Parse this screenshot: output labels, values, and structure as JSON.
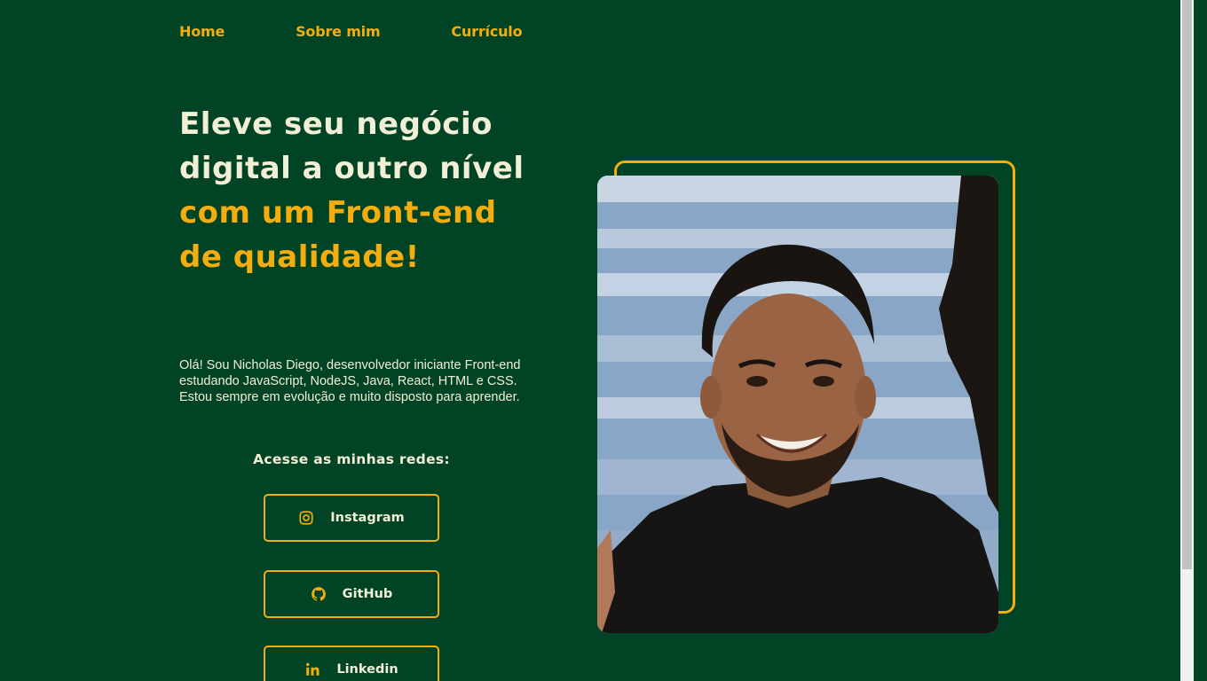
{
  "nav": {
    "items": [
      "Home",
      "Sobre mim",
      "Currículo"
    ]
  },
  "hero": {
    "headline_plain": "Eleve seu negócio digital a outro nível ",
    "headline_accent": "com um Front-end de qualidade!",
    "intro": "Olá! Sou Nicholas Diego, desenvolvedor iniciante Front-end estudando JavaScript, NodeJS, Java, React, HTML e CSS. Estou sempre em evolução e muito disposto para aprender."
  },
  "social": {
    "title": "Acesse as minhas redes:",
    "buttons": [
      {
        "label": "Instagram",
        "icon": "instagram-icon"
      },
      {
        "label": "GitHub",
        "icon": "github-icon"
      },
      {
        "label": "Linkedin",
        "icon": "linkedin-icon"
      }
    ]
  },
  "colors": {
    "background": "#014325",
    "accent": "#f4ad0f",
    "text": "#f2efd6"
  }
}
